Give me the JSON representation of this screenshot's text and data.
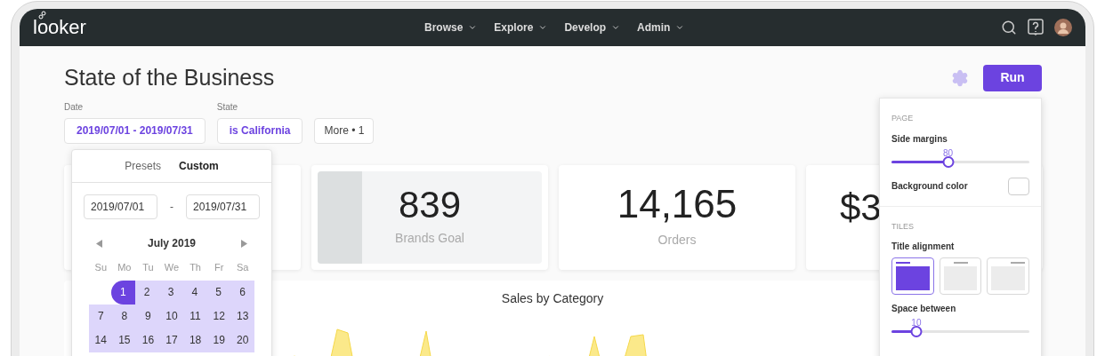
{
  "logo": "looker",
  "nav": [
    {
      "label": "Browse"
    },
    {
      "label": "Explore"
    },
    {
      "label": "Develop"
    },
    {
      "label": "Admin"
    }
  ],
  "title": "State of the Business",
  "filters": [
    {
      "label": "Date",
      "value": "2019/07/01 - 2019/07/31",
      "kind": "filter"
    },
    {
      "label": "State",
      "value": "is California",
      "kind": "filter"
    },
    {
      "value": "More • 1",
      "kind": "more"
    }
  ],
  "run_button": "Run",
  "tiles": [
    {
      "kind": "blank"
    },
    {
      "kind": "goal",
      "value": "839",
      "label": "Brands Goal",
      "level": 0.2
    },
    {
      "kind": "number",
      "value": "14,165",
      "label": "Orders"
    },
    {
      "kind": "cut",
      "value": "$3"
    }
  ],
  "chart": {
    "title": "Sales by Category"
  },
  "calendar": {
    "tabs": [
      {
        "label": "Presets",
        "selected": false
      },
      {
        "label": "Custom",
        "selected": true
      }
    ],
    "from": "2019/07/01",
    "separator": "-",
    "to": "2019/07/31",
    "month": "July 2019",
    "weekdays": [
      "Su",
      "Mo",
      "Tu",
      "We",
      "Th",
      "Fr",
      "Sa"
    ],
    "weeks": [
      [
        {
          "day": "1",
          "in_range": true,
          "selected": true
        },
        {
          "day": "2",
          "in_range": true,
          "selected": false
        },
        {
          "day": "3",
          "in_range": true,
          "selected": false
        },
        {
          "day": "4",
          "in_range": true,
          "selected": false
        },
        {
          "day": "5",
          "in_range": true,
          "selected": false
        },
        {
          "day": "6",
          "in_range": true,
          "selected": false
        }
      ],
      [
        {
          "day": "7",
          "in_range": true,
          "selected": false
        },
        {
          "day": "8",
          "in_range": true,
          "selected": false
        },
        {
          "day": "9",
          "in_range": true,
          "selected": false
        },
        {
          "day": "10",
          "in_range": true,
          "selected": false
        },
        {
          "day": "11",
          "in_range": true,
          "selected": false
        },
        {
          "day": "12",
          "in_range": true,
          "selected": false
        },
        {
          "day": "13",
          "in_range": true,
          "selected": false
        }
      ],
      [
        {
          "day": "14",
          "in_range": true,
          "selected": false
        },
        {
          "day": "15",
          "in_range": true,
          "selected": false
        },
        {
          "day": "16",
          "in_range": true,
          "selected": false
        },
        {
          "day": "17",
          "in_range": true,
          "selected": false
        },
        {
          "day": "18",
          "in_range": true,
          "selected": false
        },
        {
          "day": "19",
          "in_range": true,
          "selected": false
        },
        {
          "day": "20",
          "in_range": true,
          "selected": false
        }
      ]
    ]
  },
  "settings": {
    "sections": [
      {
        "heading": "PAGE",
        "items": [
          {
            "kind": "slider",
            "label": "Side margins",
            "reading": "80",
            "level": 0.41
          },
          {
            "kind": "color",
            "label": "Background color"
          }
        ]
      },
      {
        "heading": "TILES",
        "items": [
          {
            "kind": "alignment",
            "label": "Title alignment",
            "options": [
              {
                "selected": true
              },
              {
                "selected": false
              },
              {
                "selected": false
              }
            ]
          },
          {
            "kind": "slider",
            "label": "Space between",
            "reading": "10",
            "level": 0.18
          }
        ]
      }
    ]
  }
}
